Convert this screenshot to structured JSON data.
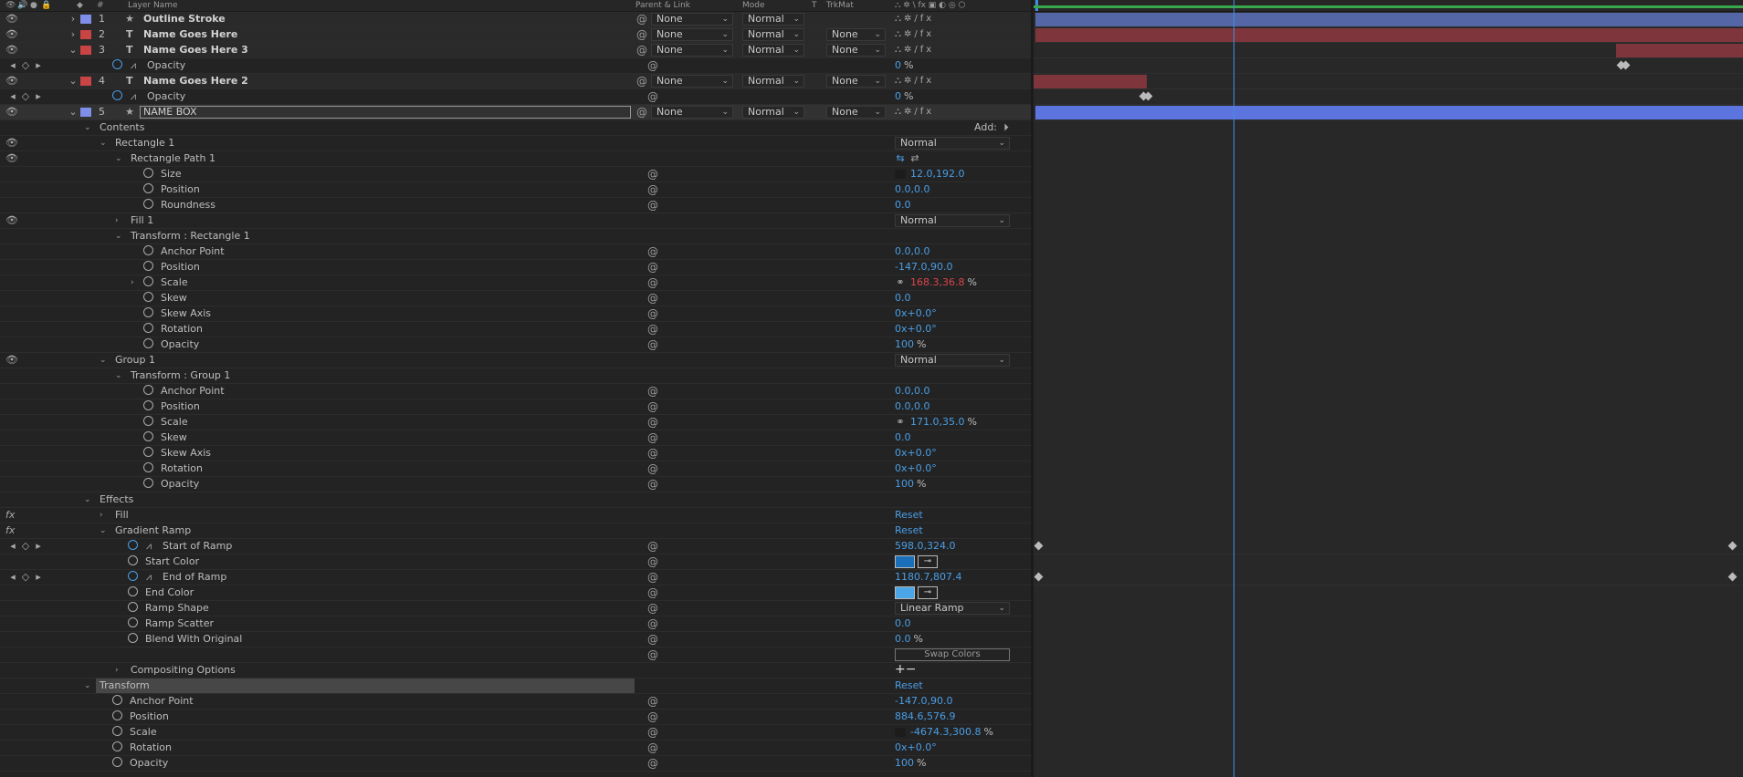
{
  "header": {
    "num_label": "#",
    "layer_name_label": "Layer Name",
    "parent_label": "Parent & Link",
    "mode_label": "Mode",
    "t_label": "T",
    "trkmat_label": "TrkMat",
    "switch_icons": "⛬ ✲ \\ fx ▣ ◐ ◎ ⬡"
  },
  "colors": {
    "label_blue": "#7f8fe8",
    "label_red": "#c94444",
    "accent_value": "#4a9ee6",
    "negative_value": "#d9454a",
    "bar_blue": "#5566a6",
    "bar_red": "#7e363c",
    "bar_gradient": "#5b74de",
    "playhead": "#3f8fe0"
  },
  "layers": [
    {
      "num": "1",
      "name": "Outline Stroke",
      "parent": "None",
      "mode": "Normal",
      "trkmat": ""
    },
    {
      "num": "2",
      "name": "Name Goes Here",
      "parent": "None",
      "mode": "Normal",
      "trkmat": "None"
    },
    {
      "num": "3",
      "name": "Name Goes Here 3",
      "parent": "None",
      "mode": "Normal",
      "trkmat": "None"
    },
    {
      "name": "Opacity",
      "value": "0",
      "unit": "%"
    },
    {
      "num": "4",
      "name": "Name Goes Here 2",
      "parent": "None",
      "mode": "Normal",
      "trkmat": "None"
    },
    {
      "name": "Opacity",
      "value": "0",
      "unit": "%"
    },
    {
      "num": "5",
      "name": "NAME BOX",
      "parent": "None",
      "mode": "Normal",
      "trkmat": "None"
    }
  ],
  "contents": {
    "label": "Contents",
    "add_label": "Add:",
    "rectangle1": {
      "label": "Rectangle 1",
      "mode": "Normal",
      "path": {
        "label": "Rectangle Path 1",
        "size": {
          "label": "Size",
          "value": "12.0,192.0"
        },
        "position": {
          "label": "Position",
          "value": "0.0,0.0"
        },
        "roundness": {
          "label": "Roundness",
          "value": "0.0"
        }
      },
      "fill": {
        "label": "Fill 1",
        "mode": "Normal"
      },
      "transform": {
        "label": "Transform : Rectangle 1",
        "anchor": {
          "label": "Anchor Point",
          "value": "0.0,0.0"
        },
        "position": {
          "label": "Position",
          "value": "-147.0,90.0"
        },
        "scale": {
          "label": "Scale",
          "value": "168.3,36.8",
          "unit": "%"
        },
        "skew": {
          "label": "Skew",
          "value": "0.0"
        },
        "skew_axis": {
          "label": "Skew Axis",
          "value": "0",
          "suffix": "x+0.0°"
        },
        "rotation": {
          "label": "Rotation",
          "value": "0",
          "suffix": "x+0.0°"
        },
        "opacity": {
          "label": "Opacity",
          "value": "100",
          "unit": "%"
        }
      }
    },
    "group1": {
      "label": "Group 1",
      "mode": "Normal",
      "transform": {
        "label": "Transform : Group 1",
        "anchor": {
          "label": "Anchor Point",
          "value": "0.0,0.0"
        },
        "position": {
          "label": "Position",
          "value": "0.0,0.0"
        },
        "scale": {
          "label": "Scale",
          "value": "171.0,35.0",
          "unit": "%"
        },
        "skew": {
          "label": "Skew",
          "value": "0.0"
        },
        "skew_axis": {
          "label": "Skew Axis",
          "value": "0",
          "suffix": "x+0.0°"
        },
        "rotation": {
          "label": "Rotation",
          "value": "0",
          "suffix": "x+0.0°"
        },
        "opacity": {
          "label": "Opacity",
          "value": "100",
          "unit": "%"
        }
      }
    }
  },
  "effects": {
    "label": "Effects",
    "fill": {
      "label": "Fill",
      "reset": "Reset"
    },
    "gradient_ramp": {
      "label": "Gradient Ramp",
      "reset": "Reset",
      "start_of_ramp": {
        "label": "Start of Ramp",
        "value": "598.0,324.0"
      },
      "start_color": {
        "label": "Start Color",
        "color": "#1a6fb8"
      },
      "end_of_ramp": {
        "label": "End of Ramp",
        "value": "1180.7,807.4"
      },
      "end_color": {
        "label": "End Color",
        "color": "#4aa6e6"
      },
      "ramp_shape": {
        "label": "Ramp Shape",
        "value": "Linear Ramp"
      },
      "ramp_scatter": {
        "label": "Ramp Scatter",
        "value": "0.0"
      },
      "blend": {
        "label": "Blend With Original",
        "value": "0.0",
        "unit": "%"
      },
      "swap_colors": "Swap Colors"
    }
  },
  "compositing_options": {
    "label": "Compositing Options",
    "plusminus": "+−"
  },
  "transform": {
    "label": "Transform",
    "reset": "Reset",
    "anchor": {
      "label": "Anchor Point",
      "value": "-147.0,90.0"
    },
    "position": {
      "label": "Position",
      "value": "884.6,576.9"
    },
    "scale": {
      "label": "Scale",
      "value": "-4674.3,300.8",
      "unit": "%"
    },
    "rotation": {
      "label": "Rotation",
      "value": "0",
      "suffix": "x+0.0°"
    },
    "opacity": {
      "label": "Opacity",
      "value": "100",
      "unit": "%"
    }
  }
}
